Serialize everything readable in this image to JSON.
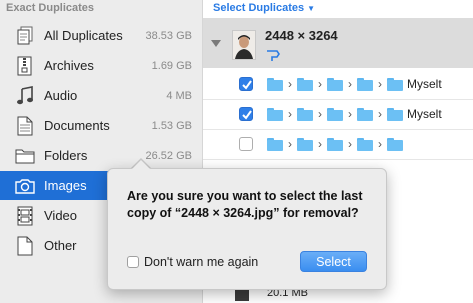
{
  "sidebar": {
    "header": "Exact Duplicates",
    "items": [
      {
        "label": "All Duplicates",
        "size": "38.53 GB",
        "icon": "documents-stack-icon"
      },
      {
        "label": "Archives",
        "size": "1.69 GB",
        "icon": "archive-icon"
      },
      {
        "label": "Audio",
        "size": "4 MB",
        "icon": "music-note-icon"
      },
      {
        "label": "Documents",
        "size": "1.53 GB",
        "icon": "document-icon"
      },
      {
        "label": "Folders",
        "size": "26.52 GB",
        "icon": "folder-icon"
      },
      {
        "label": "Images",
        "size": "",
        "icon": "camera-icon",
        "selected": true
      },
      {
        "label": "Video",
        "size": "",
        "icon": "film-icon"
      },
      {
        "label": "Other",
        "size": "",
        "icon": "blank-file-icon"
      }
    ]
  },
  "main": {
    "select_duplicates": "Select Duplicates",
    "group": {
      "title": "2448 × 3264"
    },
    "rows": [
      {
        "checked": true,
        "last_segment": "Myselt"
      },
      {
        "checked": true,
        "last_segment": "Myselt"
      },
      {
        "checked": false,
        "last_segment": ""
      }
    ],
    "lower_size": "20.1 MB"
  },
  "dialog": {
    "message": "Are you sure you want to select the last copy of “2448 × 3264.jpg” for removal?",
    "dont_warn": "Don't warn me again",
    "select_button": "Select"
  },
  "colors": {
    "accent": "#1f6fd6",
    "link": "#2a7be4",
    "folder": "#6cc0f4"
  }
}
